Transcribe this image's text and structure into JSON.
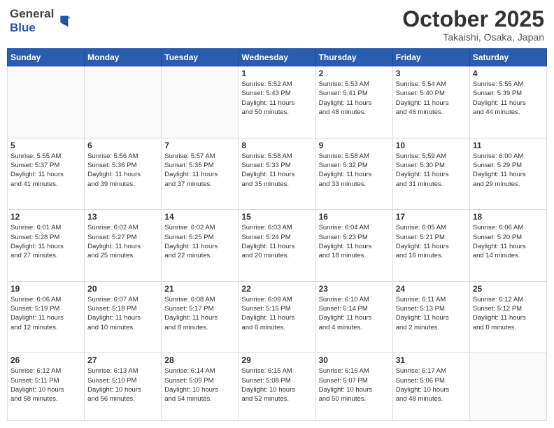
{
  "logo": {
    "general": "General",
    "blue": "Blue"
  },
  "header": {
    "month": "October 2025",
    "location": "Takaishi, Osaka, Japan"
  },
  "weekdays": [
    "Sunday",
    "Monday",
    "Tuesday",
    "Wednesday",
    "Thursday",
    "Friday",
    "Saturday"
  ],
  "weeks": [
    [
      {
        "day": "",
        "info": ""
      },
      {
        "day": "",
        "info": ""
      },
      {
        "day": "",
        "info": ""
      },
      {
        "day": "1",
        "info": "Sunrise: 5:52 AM\nSunset: 5:43 PM\nDaylight: 11 hours\nand 50 minutes."
      },
      {
        "day": "2",
        "info": "Sunrise: 5:53 AM\nSunset: 5:41 PM\nDaylight: 11 hours\nand 48 minutes."
      },
      {
        "day": "3",
        "info": "Sunrise: 5:54 AM\nSunset: 5:40 PM\nDaylight: 11 hours\nand 46 minutes."
      },
      {
        "day": "4",
        "info": "Sunrise: 5:55 AM\nSunset: 5:39 PM\nDaylight: 11 hours\nand 44 minutes."
      }
    ],
    [
      {
        "day": "5",
        "info": "Sunrise: 5:55 AM\nSunset: 5:37 PM\nDaylight: 11 hours\nand 41 minutes."
      },
      {
        "day": "6",
        "info": "Sunrise: 5:56 AM\nSunset: 5:36 PM\nDaylight: 11 hours\nand 39 minutes."
      },
      {
        "day": "7",
        "info": "Sunrise: 5:57 AM\nSunset: 5:35 PM\nDaylight: 11 hours\nand 37 minutes."
      },
      {
        "day": "8",
        "info": "Sunrise: 5:58 AM\nSunset: 5:33 PM\nDaylight: 11 hours\nand 35 minutes."
      },
      {
        "day": "9",
        "info": "Sunrise: 5:58 AM\nSunset: 5:32 PM\nDaylight: 11 hours\nand 33 minutes."
      },
      {
        "day": "10",
        "info": "Sunrise: 5:59 AM\nSunset: 5:30 PM\nDaylight: 11 hours\nand 31 minutes."
      },
      {
        "day": "11",
        "info": "Sunrise: 6:00 AM\nSunset: 5:29 PM\nDaylight: 11 hours\nand 29 minutes."
      }
    ],
    [
      {
        "day": "12",
        "info": "Sunrise: 6:01 AM\nSunset: 5:28 PM\nDaylight: 11 hours\nand 27 minutes."
      },
      {
        "day": "13",
        "info": "Sunrise: 6:02 AM\nSunset: 5:27 PM\nDaylight: 11 hours\nand 25 minutes."
      },
      {
        "day": "14",
        "info": "Sunrise: 6:02 AM\nSunset: 5:25 PM\nDaylight: 11 hours\nand 22 minutes."
      },
      {
        "day": "15",
        "info": "Sunrise: 6:03 AM\nSunset: 5:24 PM\nDaylight: 11 hours\nand 20 minutes."
      },
      {
        "day": "16",
        "info": "Sunrise: 6:04 AM\nSunset: 5:23 PM\nDaylight: 11 hours\nand 18 minutes."
      },
      {
        "day": "17",
        "info": "Sunrise: 6:05 AM\nSunset: 5:21 PM\nDaylight: 11 hours\nand 16 minutes."
      },
      {
        "day": "18",
        "info": "Sunrise: 6:06 AM\nSunset: 5:20 PM\nDaylight: 11 hours\nand 14 minutes."
      }
    ],
    [
      {
        "day": "19",
        "info": "Sunrise: 6:06 AM\nSunset: 5:19 PM\nDaylight: 11 hours\nand 12 minutes."
      },
      {
        "day": "20",
        "info": "Sunrise: 6:07 AM\nSunset: 5:18 PM\nDaylight: 11 hours\nand 10 minutes."
      },
      {
        "day": "21",
        "info": "Sunrise: 6:08 AM\nSunset: 5:17 PM\nDaylight: 11 hours\nand 8 minutes."
      },
      {
        "day": "22",
        "info": "Sunrise: 6:09 AM\nSunset: 5:15 PM\nDaylight: 11 hours\nand 6 minutes."
      },
      {
        "day": "23",
        "info": "Sunrise: 6:10 AM\nSunset: 5:14 PM\nDaylight: 11 hours\nand 4 minutes."
      },
      {
        "day": "24",
        "info": "Sunrise: 6:11 AM\nSunset: 5:13 PM\nDaylight: 11 hours\nand 2 minutes."
      },
      {
        "day": "25",
        "info": "Sunrise: 6:12 AM\nSunset: 5:12 PM\nDaylight: 11 hours\nand 0 minutes."
      }
    ],
    [
      {
        "day": "26",
        "info": "Sunrise: 6:12 AM\nSunset: 5:11 PM\nDaylight: 10 hours\nand 58 minutes."
      },
      {
        "day": "27",
        "info": "Sunrise: 6:13 AM\nSunset: 5:10 PM\nDaylight: 10 hours\nand 56 minutes."
      },
      {
        "day": "28",
        "info": "Sunrise: 6:14 AM\nSunset: 5:09 PM\nDaylight: 10 hours\nand 54 minutes."
      },
      {
        "day": "29",
        "info": "Sunrise: 6:15 AM\nSunset: 5:08 PM\nDaylight: 10 hours\nand 52 minutes."
      },
      {
        "day": "30",
        "info": "Sunrise: 6:16 AM\nSunset: 5:07 PM\nDaylight: 10 hours\nand 50 minutes."
      },
      {
        "day": "31",
        "info": "Sunrise: 6:17 AM\nSunset: 5:06 PM\nDaylight: 10 hours\nand 48 minutes."
      },
      {
        "day": "",
        "info": ""
      }
    ]
  ]
}
